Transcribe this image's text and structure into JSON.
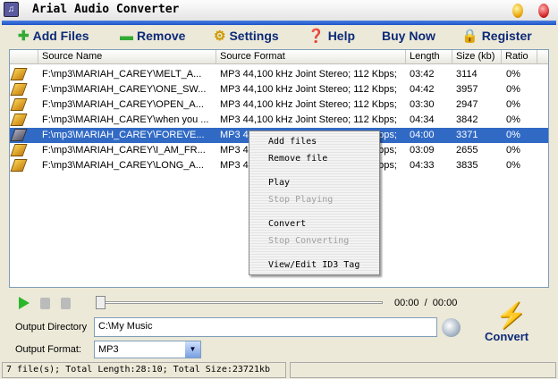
{
  "window": {
    "title": "Arial Audio Converter"
  },
  "toolbar": {
    "add": "Add Files",
    "remove": "Remove",
    "settings": "Settings",
    "help": "Help",
    "buy": "Buy Now",
    "register": "Register"
  },
  "columns": [
    "Source Name",
    "Source Format",
    "Length",
    "Size (kb)",
    "Ratio"
  ],
  "rows": [
    {
      "name": "F:\\mp3\\MARIAH_CAREY\\MELT_A...",
      "format": "MP3  44,100 kHz Joint Stereo;  112 Kbps;",
      "length": "03:42",
      "size": "3114",
      "ratio": "0%"
    },
    {
      "name": "F:\\mp3\\MARIAH_CAREY\\ONE_SW...",
      "format": "MP3  44,100 kHz Joint Stereo;  112 Kbps;",
      "length": "04:42",
      "size": "3957",
      "ratio": "0%"
    },
    {
      "name": "F:\\mp3\\MARIAH_CAREY\\OPEN_A...",
      "format": "MP3  44,100 kHz Joint Stereo;  112 Kbps;",
      "length": "03:30",
      "size": "2947",
      "ratio": "0%"
    },
    {
      "name": "F:\\mp3\\MARIAH_CAREY\\when you ...",
      "format": "MP3  44,100 kHz Joint Stereo;  112 Kbps;",
      "length": "04:34",
      "size": "3842",
      "ratio": "0%"
    },
    {
      "name": "F:\\mp3\\MARIAH_CAREY\\FOREVE...",
      "format": "MP3  44,100 kHz Joint Stereo;  112 Kbps;",
      "length": "04:00",
      "size": "3371",
      "ratio": "0%",
      "selected": true
    },
    {
      "name": "F:\\mp3\\MARIAH_CAREY\\I_AM_FR...",
      "format": "MP3  44,100 kHz Joint Stereo;  112 Kbps;",
      "length": "03:09",
      "size": "2655",
      "ratio": "0%"
    },
    {
      "name": "F:\\mp3\\MARIAH_CAREY\\LONG_A...",
      "format": "MP3  44,100 kHz Joint Stereo;  112 Kbps;",
      "length": "04:33",
      "size": "3835",
      "ratio": "0%"
    }
  ],
  "context_menu": [
    {
      "label": "Add files",
      "enabled": true
    },
    {
      "label": "Remove file",
      "enabled": true
    },
    {
      "label": "Play",
      "enabled": true
    },
    {
      "label": "Stop Playing",
      "enabled": false
    },
    {
      "label": "Convert",
      "enabled": true
    },
    {
      "label": "Stop Converting",
      "enabled": false
    },
    {
      "label": "View/Edit ID3 Tag",
      "enabled": true
    }
  ],
  "player": {
    "time": "00:00  /  00:00",
    "position": 0
  },
  "output": {
    "dir_label": "Output Directory",
    "dir_value": "C:\\My Music",
    "format_label": "Output Format:",
    "format_value": "MP3"
  },
  "convert_label": "Convert",
  "status": "7 file(s); Total Length:28:10; Total Size:23721kb"
}
